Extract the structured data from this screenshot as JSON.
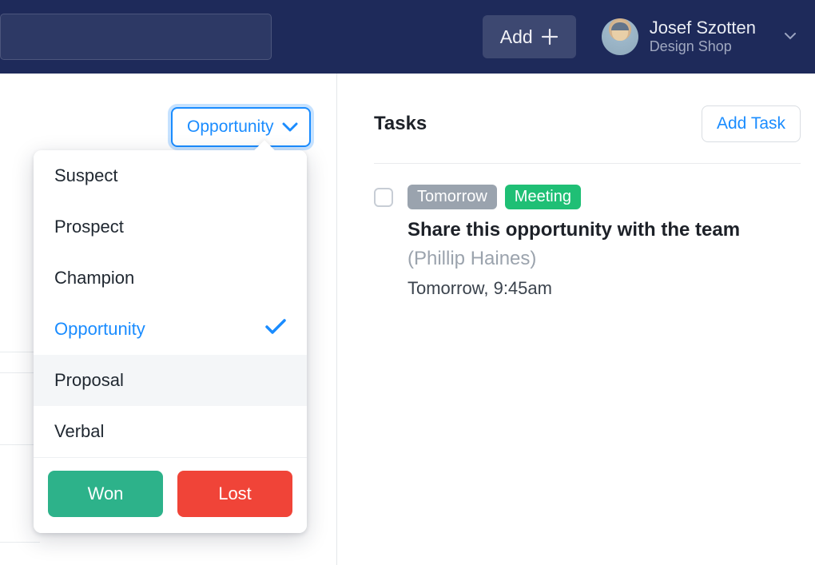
{
  "header": {
    "search_placeholder": "",
    "add_label": "Add",
    "user": {
      "name": "Josef Szotten",
      "subtitle": "Design Shop"
    }
  },
  "stage": {
    "button_label": "Opportunity",
    "options": [
      {
        "label": "Suspect",
        "selected": false
      },
      {
        "label": "Prospect",
        "selected": false
      },
      {
        "label": "Champion",
        "selected": false
      },
      {
        "label": "Opportunity",
        "selected": true
      },
      {
        "label": "Proposal",
        "selected": false,
        "hover": true
      },
      {
        "label": "Verbal",
        "selected": false
      }
    ],
    "won_label": "Won",
    "lost_label": "Lost"
  },
  "tasks": {
    "heading": "Tasks",
    "add_task_label": "Add Task",
    "items": [
      {
        "badge_due": "Tomorrow",
        "badge_type": "Meeting",
        "title": "Share this opportunity with the team",
        "assignee": "(Phillip Haines)",
        "time": "Tomorrow, 9:45am"
      }
    ]
  }
}
